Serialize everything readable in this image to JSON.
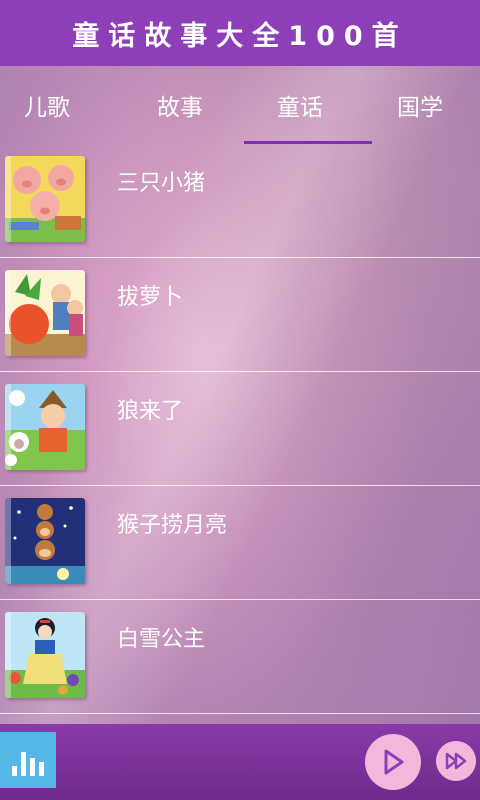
{
  "app": {
    "title": "童话故事大全100首"
  },
  "tabs": [
    {
      "label": "儿歌",
      "selected": false
    },
    {
      "label": "故事",
      "selected": false
    },
    {
      "label": "童话",
      "selected": true
    },
    {
      "label": "国学",
      "selected": false
    }
  ],
  "stories": [
    {
      "title": "三只小猪",
      "thumbnail_icon": "three-little-pigs-cover"
    },
    {
      "title": "拔萝卜",
      "thumbnail_icon": "pulling-radish-cover"
    },
    {
      "title": "狼来了",
      "thumbnail_icon": "boy-who-cried-wolf-cover"
    },
    {
      "title": "猴子捞月亮",
      "thumbnail_icon": "monkeys-scoop-moon-cover"
    },
    {
      "title": "白雪公主",
      "thumbnail_icon": "snow-white-cover"
    }
  ],
  "player": {
    "equalizer_icon": "equalizer-icon",
    "play_icon": "play-icon",
    "next_icon": "fast-forward-icon"
  },
  "colors": {
    "title_bar": "#8d3fb8",
    "tab_indicator": "#7c2fb0",
    "player_bar": "#7a309a",
    "equalizer_button": "#55b8e8",
    "player_buttons": "#f1b8dc",
    "player_icon": "#8d3fb8"
  }
}
